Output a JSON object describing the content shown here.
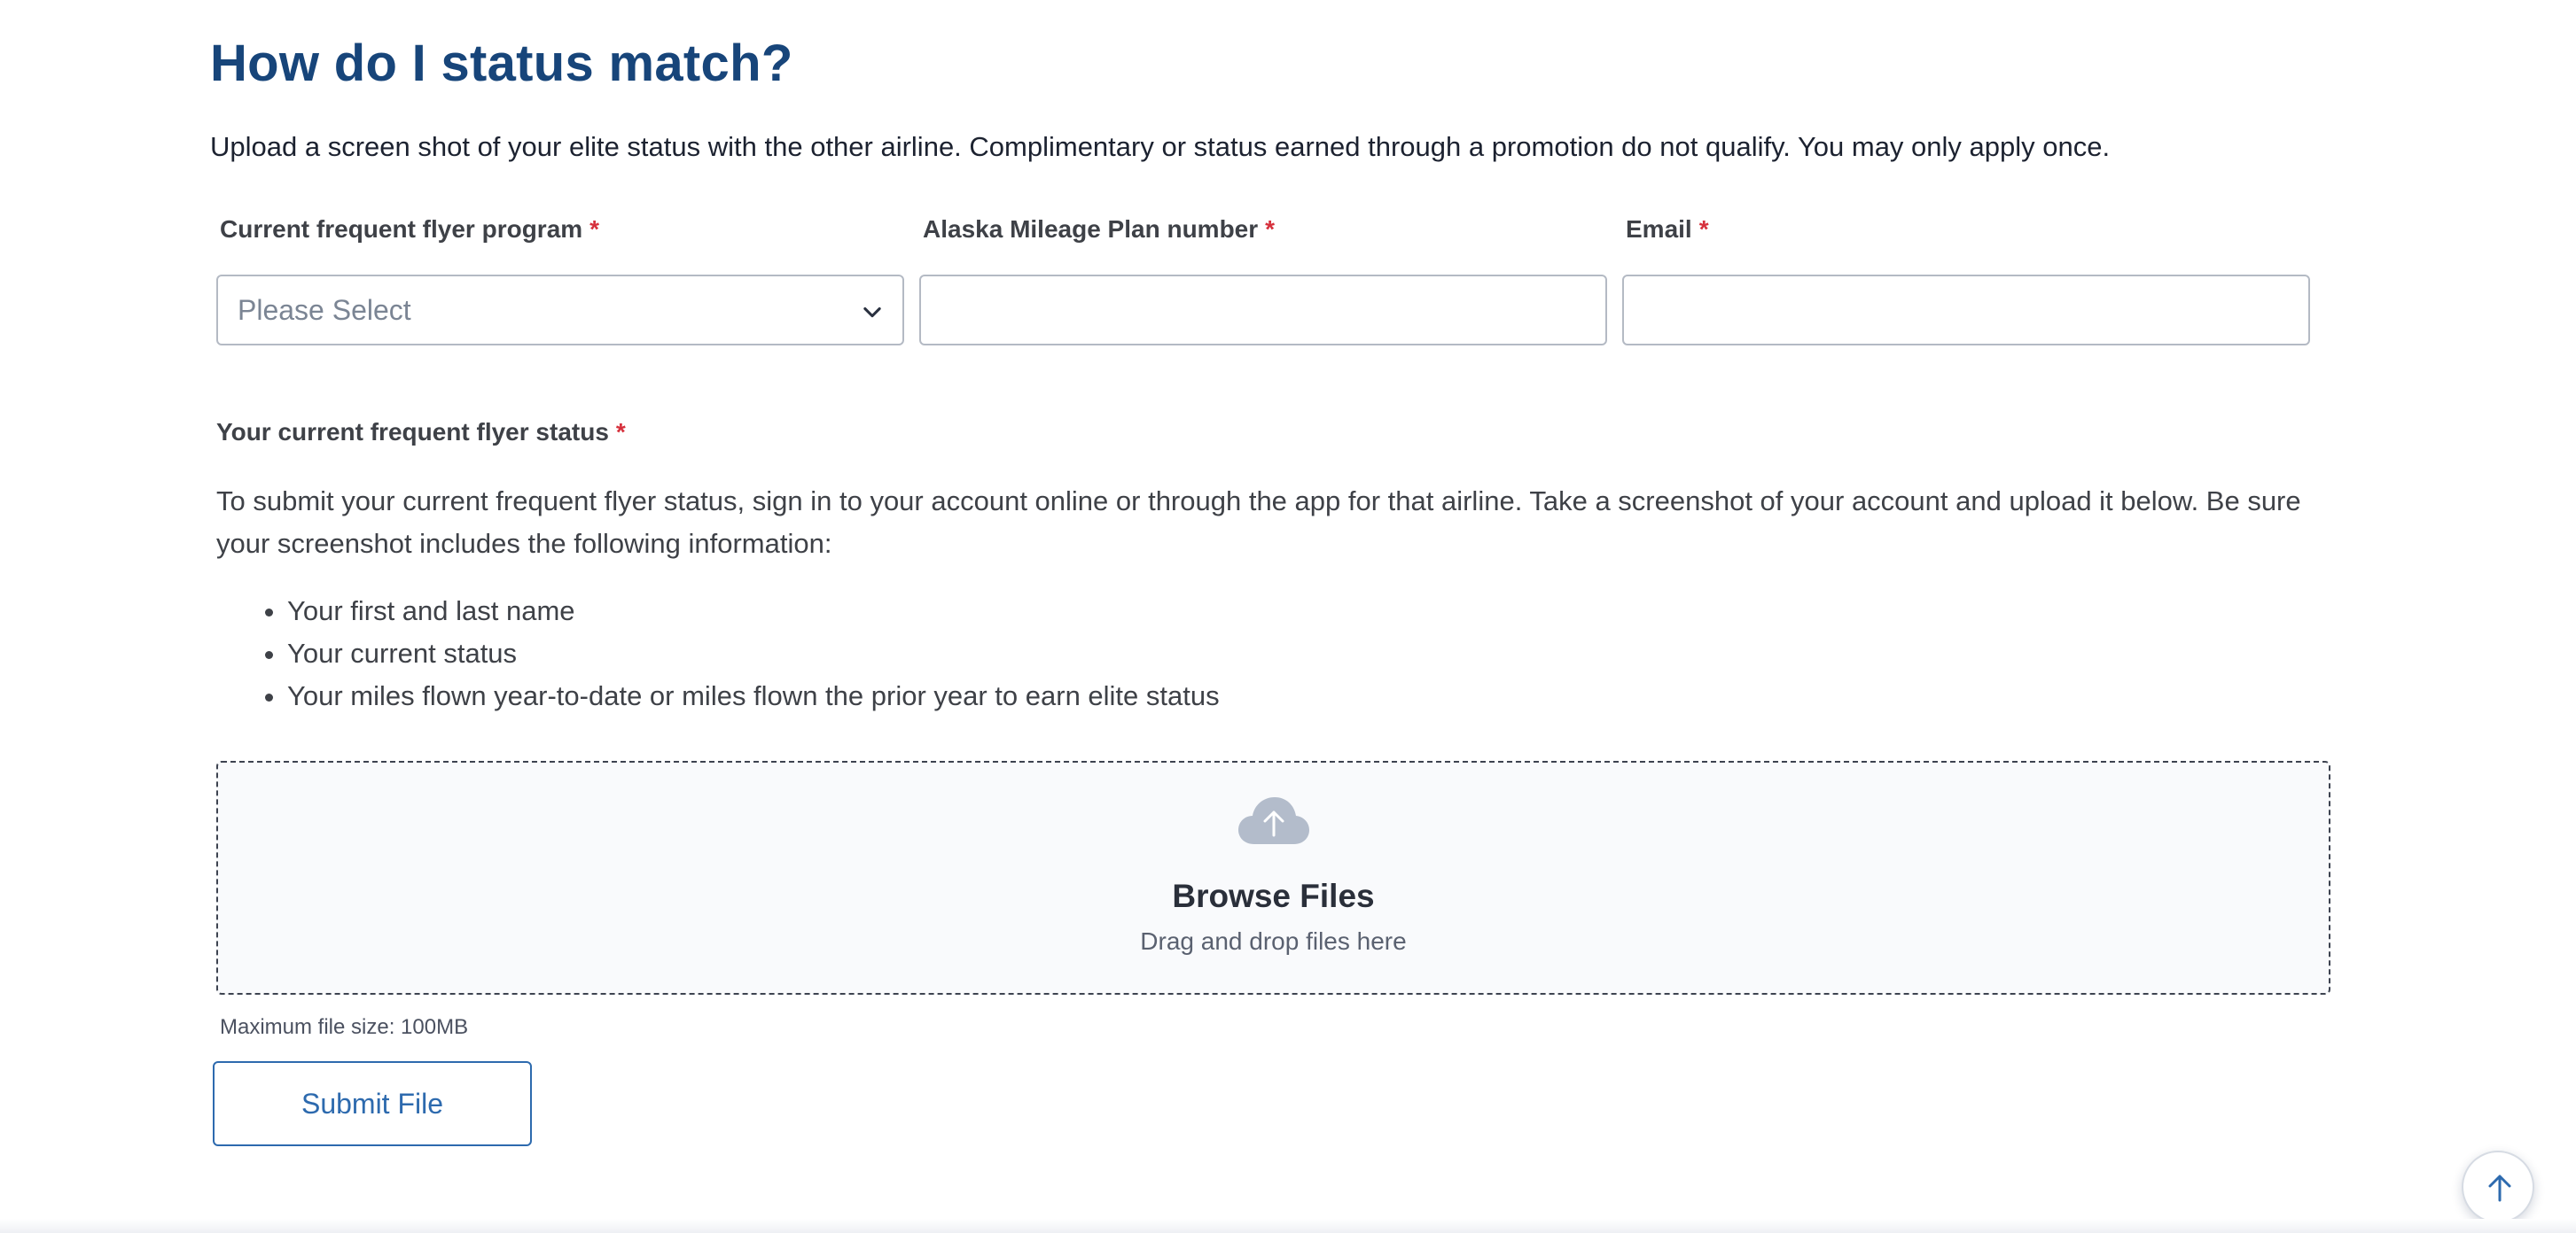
{
  "section": {
    "title": "How do I status match?",
    "intro": "Upload a screen shot of your elite status with the other airline. Complimentary or status earned through a promotion do not qualify. You may only apply once."
  },
  "form": {
    "required_mark": "*",
    "program": {
      "label": "Current frequent flyer program",
      "placeholder": "Please Select",
      "value": ""
    },
    "mileage": {
      "label": "Alaska Mileage Plan number",
      "value": ""
    },
    "email": {
      "label": "Email",
      "value": ""
    }
  },
  "status": {
    "label": "Your current frequent flyer status",
    "instructions": "To submit your current frequent flyer status, sign in to your account online or through the app for that airline. Take a screenshot of your account and upload it below. Be sure your screenshot includes the following information:",
    "requirements": [
      "Your first and last name",
      "Your current status",
      "Your miles flown year-to-date or miles flown the prior year to earn elite status"
    ]
  },
  "upload": {
    "title": "Browse Files",
    "subtitle": "Drag and drop files here",
    "max_size": "Maximum file size: 100MB",
    "icon": "cloud-upload-icon"
  },
  "actions": {
    "submit_label": "Submit File",
    "scroll_top_icon": "arrow-up-icon"
  },
  "colors": {
    "heading": "#17457a",
    "required": "#d6303c",
    "accent": "#2d6aae",
    "icon_gray": "#b3bccb"
  }
}
